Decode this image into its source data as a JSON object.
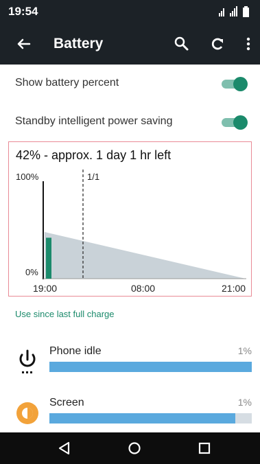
{
  "status": {
    "time": "19:54",
    "icons": [
      "signal-icon",
      "signal-icon",
      "battery-icon"
    ]
  },
  "toolbar": {
    "title": "Battery",
    "icons": {
      "back": "arrow-left-icon",
      "search": "search-icon",
      "refresh": "refresh-icon",
      "menu": "more-vert-icon"
    }
  },
  "settings": [
    {
      "label": "Show battery percent",
      "enabled": true
    },
    {
      "label": "Standby intelligent power saving",
      "enabled": true
    }
  ],
  "graph": {
    "summary": "42% - approx. 1 day 1 hr left",
    "marker_label": "1/1",
    "y_top_label": "100%",
    "y_bottom_label": "0%",
    "x_labels": [
      "19:00",
      "08:00",
      "21:00"
    ],
    "current_level_pct": 42
  },
  "section": {
    "title": "Use since last full charge"
  },
  "usage": [
    {
      "name": "Phone idle",
      "percent": "1%",
      "bar_fraction": 1.0,
      "icon": "power-icon"
    },
    {
      "name": "Screen",
      "percent": "1%",
      "bar_fraction": 0.92,
      "icon": "brightness-icon"
    }
  ],
  "colors": {
    "accent": "#1b8a6b",
    "toolbar": "#1c2227",
    "bar": "#5aa9de",
    "graph_border": "#e98a95"
  },
  "navbar": {
    "icons": [
      "back-triangle-icon",
      "home-circle-icon",
      "recents-square-icon"
    ]
  }
}
